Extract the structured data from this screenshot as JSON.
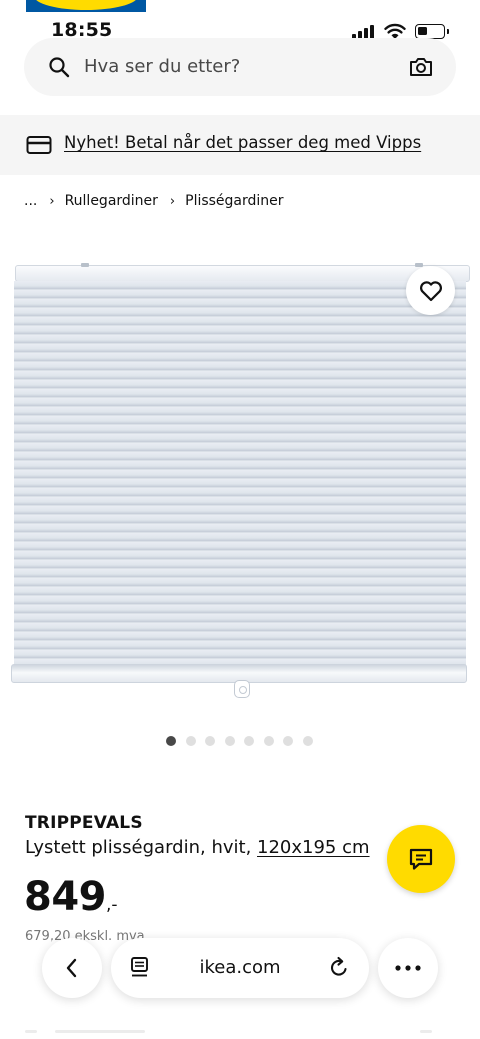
{
  "status_bar": {
    "time": "18:55"
  },
  "search": {
    "placeholder": "Hva ser du etter?"
  },
  "promo": {
    "text": "Nyhet! Betal når det passer deg med Vipps"
  },
  "breadcrumb": {
    "ellipsis": "...",
    "items": [
      "Rullegardiner",
      "Plisségardiner"
    ]
  },
  "gallery": {
    "image_count": 8,
    "active_index": 0
  },
  "product": {
    "name": "TRIPPEVALS",
    "description": "Lystett plisségardin, hvit, ",
    "size": "120x195 cm",
    "price": "849",
    "price_suffix": ",-",
    "price_excl_vat": "679,20 ekskl. mva"
  },
  "browser": {
    "url": "ikea.com"
  },
  "colors": {
    "brand_yellow": "#ffdb00",
    "brand_blue": "#0058a3",
    "bar_bg": "#f5f5f5"
  }
}
